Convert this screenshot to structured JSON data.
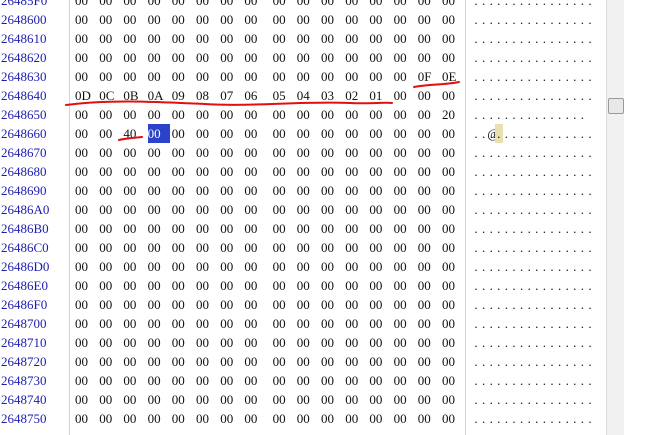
{
  "hex_view": {
    "rows": [
      {
        "offset": "26485F0",
        "bytes": [
          "00",
          "00",
          "00",
          "00",
          "00",
          "00",
          "00",
          "00",
          "00",
          "00",
          "00",
          "00",
          "00",
          "00",
          "00",
          "00"
        ],
        "ascii": "................"
      },
      {
        "offset": "2648600",
        "bytes": [
          "00",
          "00",
          "00",
          "00",
          "00",
          "00",
          "00",
          "00",
          "00",
          "00",
          "00",
          "00",
          "00",
          "00",
          "00",
          "00"
        ],
        "ascii": "................"
      },
      {
        "offset": "2648610",
        "bytes": [
          "00",
          "00",
          "00",
          "00",
          "00",
          "00",
          "00",
          "00",
          "00",
          "00",
          "00",
          "00",
          "00",
          "00",
          "00",
          "00"
        ],
        "ascii": "................"
      },
      {
        "offset": "2648620",
        "bytes": [
          "00",
          "00",
          "00",
          "00",
          "00",
          "00",
          "00",
          "00",
          "00",
          "00",
          "00",
          "00",
          "00",
          "00",
          "00",
          "00"
        ],
        "ascii": "................"
      },
      {
        "offset": "2648630",
        "bytes": [
          "00",
          "00",
          "00",
          "00",
          "00",
          "00",
          "00",
          "00",
          "00",
          "00",
          "00",
          "00",
          "00",
          "00",
          "0F",
          "0E"
        ],
        "ascii": "................"
      },
      {
        "offset": "2648640",
        "bytes": [
          "0D",
          "0C",
          "0B",
          "0A",
          "09",
          "08",
          "07",
          "06",
          "05",
          "04",
          "03",
          "02",
          "01",
          "00",
          "00",
          "00"
        ],
        "ascii": "................"
      },
      {
        "offset": "2648650",
        "bytes": [
          "00",
          "00",
          "00",
          "00",
          "00",
          "00",
          "00",
          "00",
          "00",
          "00",
          "00",
          "00",
          "00",
          "00",
          "00",
          "20"
        ],
        "ascii": "............... "
      },
      {
        "offset": "2648660",
        "bytes": [
          "00",
          "00",
          "40",
          "00",
          "00",
          "00",
          "00",
          "00",
          "00",
          "00",
          "00",
          "00",
          "00",
          "00",
          "00",
          "00"
        ],
        "ascii": "..@............."
      },
      {
        "offset": "2648670",
        "bytes": [
          "00",
          "00",
          "00",
          "00",
          "00",
          "00",
          "00",
          "00",
          "00",
          "00",
          "00",
          "00",
          "00",
          "00",
          "00",
          "00"
        ],
        "ascii": "................"
      },
      {
        "offset": "2648680",
        "bytes": [
          "00",
          "00",
          "00",
          "00",
          "00",
          "00",
          "00",
          "00",
          "00",
          "00",
          "00",
          "00",
          "00",
          "00",
          "00",
          "00"
        ],
        "ascii": "................"
      },
      {
        "offset": "2648690",
        "bytes": [
          "00",
          "00",
          "00",
          "00",
          "00",
          "00",
          "00",
          "00",
          "00",
          "00",
          "00",
          "00",
          "00",
          "00",
          "00",
          "00"
        ],
        "ascii": "................"
      },
      {
        "offset": "26486A0",
        "bytes": [
          "00",
          "00",
          "00",
          "00",
          "00",
          "00",
          "00",
          "00",
          "00",
          "00",
          "00",
          "00",
          "00",
          "00",
          "00",
          "00"
        ],
        "ascii": "................"
      },
      {
        "offset": "26486B0",
        "bytes": [
          "00",
          "00",
          "00",
          "00",
          "00",
          "00",
          "00",
          "00",
          "00",
          "00",
          "00",
          "00",
          "00",
          "00",
          "00",
          "00"
        ],
        "ascii": "................"
      },
      {
        "offset": "26486C0",
        "bytes": [
          "00",
          "00",
          "00",
          "00",
          "00",
          "00",
          "00",
          "00",
          "00",
          "00",
          "00",
          "00",
          "00",
          "00",
          "00",
          "00"
        ],
        "ascii": "................"
      },
      {
        "offset": "26486D0",
        "bytes": [
          "00",
          "00",
          "00",
          "00",
          "00",
          "00",
          "00",
          "00",
          "00",
          "00",
          "00",
          "00",
          "00",
          "00",
          "00",
          "00"
        ],
        "ascii": "................"
      },
      {
        "offset": "26486E0",
        "bytes": [
          "00",
          "00",
          "00",
          "00",
          "00",
          "00",
          "00",
          "00",
          "00",
          "00",
          "00",
          "00",
          "00",
          "00",
          "00",
          "00"
        ],
        "ascii": "................"
      },
      {
        "offset": "26486F0",
        "bytes": [
          "00",
          "00",
          "00",
          "00",
          "00",
          "00",
          "00",
          "00",
          "00",
          "00",
          "00",
          "00",
          "00",
          "00",
          "00",
          "00"
        ],
        "ascii": "................"
      },
      {
        "offset": "2648700",
        "bytes": [
          "00",
          "00",
          "00",
          "00",
          "00",
          "00",
          "00",
          "00",
          "00",
          "00",
          "00",
          "00",
          "00",
          "00",
          "00",
          "00"
        ],
        "ascii": "................"
      },
      {
        "offset": "2648710",
        "bytes": [
          "00",
          "00",
          "00",
          "00",
          "00",
          "00",
          "00",
          "00",
          "00",
          "00",
          "00",
          "00",
          "00",
          "00",
          "00",
          "00"
        ],
        "ascii": "................"
      },
      {
        "offset": "2648720",
        "bytes": [
          "00",
          "00",
          "00",
          "00",
          "00",
          "00",
          "00",
          "00",
          "00",
          "00",
          "00",
          "00",
          "00",
          "00",
          "00",
          "00"
        ],
        "ascii": "................"
      },
      {
        "offset": "2648730",
        "bytes": [
          "00",
          "00",
          "00",
          "00",
          "00",
          "00",
          "00",
          "00",
          "00",
          "00",
          "00",
          "00",
          "00",
          "00",
          "00",
          "00"
        ],
        "ascii": "................"
      },
      {
        "offset": "2648740",
        "bytes": [
          "00",
          "00",
          "00",
          "00",
          "00",
          "00",
          "00",
          "00",
          "00",
          "00",
          "00",
          "00",
          "00",
          "00",
          "00",
          "00"
        ],
        "ascii": "................"
      },
      {
        "offset": "2648750",
        "bytes": [
          "00",
          "00",
          "00",
          "00",
          "00",
          "00",
          "00",
          "00",
          "00",
          "00",
          "00",
          "00",
          "00",
          "00",
          "00",
          "00"
        ],
        "ascii": "................"
      }
    ],
    "selected_byte": {
      "row": 7,
      "col": 3
    },
    "highlighted_ascii": {
      "row": 7,
      "col": 3
    }
  },
  "colors": {
    "offset_text": "#1c1cb0",
    "selection": "#2a43c8",
    "annotation": "#e01010"
  },
  "scrollbar": {
    "position_fraction": 0.23
  }
}
